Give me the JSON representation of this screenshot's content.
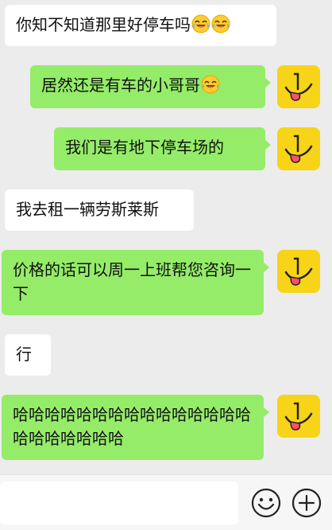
{
  "messages": [
    {
      "side": "left",
      "text": "你知不知道那里好停车吗",
      "emoji_count": 2
    },
    {
      "side": "right",
      "text": "居然还是有车的小哥哥",
      "emoji_count": 1
    },
    {
      "side": "right",
      "text": "我们是有地下停车场的",
      "emoji_count": 0
    },
    {
      "side": "left",
      "text": "我去租一辆劳斯莱斯",
      "emoji_count": 0
    },
    {
      "side": "right",
      "text": "价格的话可以周一上班帮您咨询一下",
      "emoji_count": 0
    },
    {
      "side": "left",
      "text": "行",
      "emoji_count": 0
    },
    {
      "side": "right",
      "text": "哈哈哈哈哈哈哈哈哈哈哈哈哈哈哈哈哈哈哈哈哈哈",
      "emoji_count": 0
    }
  ],
  "icons": {
    "laugh_emoji": "face-with-tears-of-joy-icon",
    "avatar": "tongue-face-avatar",
    "emoji_button": "smiley-icon",
    "plus_button": "plus-icon"
  },
  "colors": {
    "background": "#ececec",
    "bubble_left": "#ffffff",
    "bubble_right": "#95ec69",
    "avatar": "#f7d417"
  }
}
